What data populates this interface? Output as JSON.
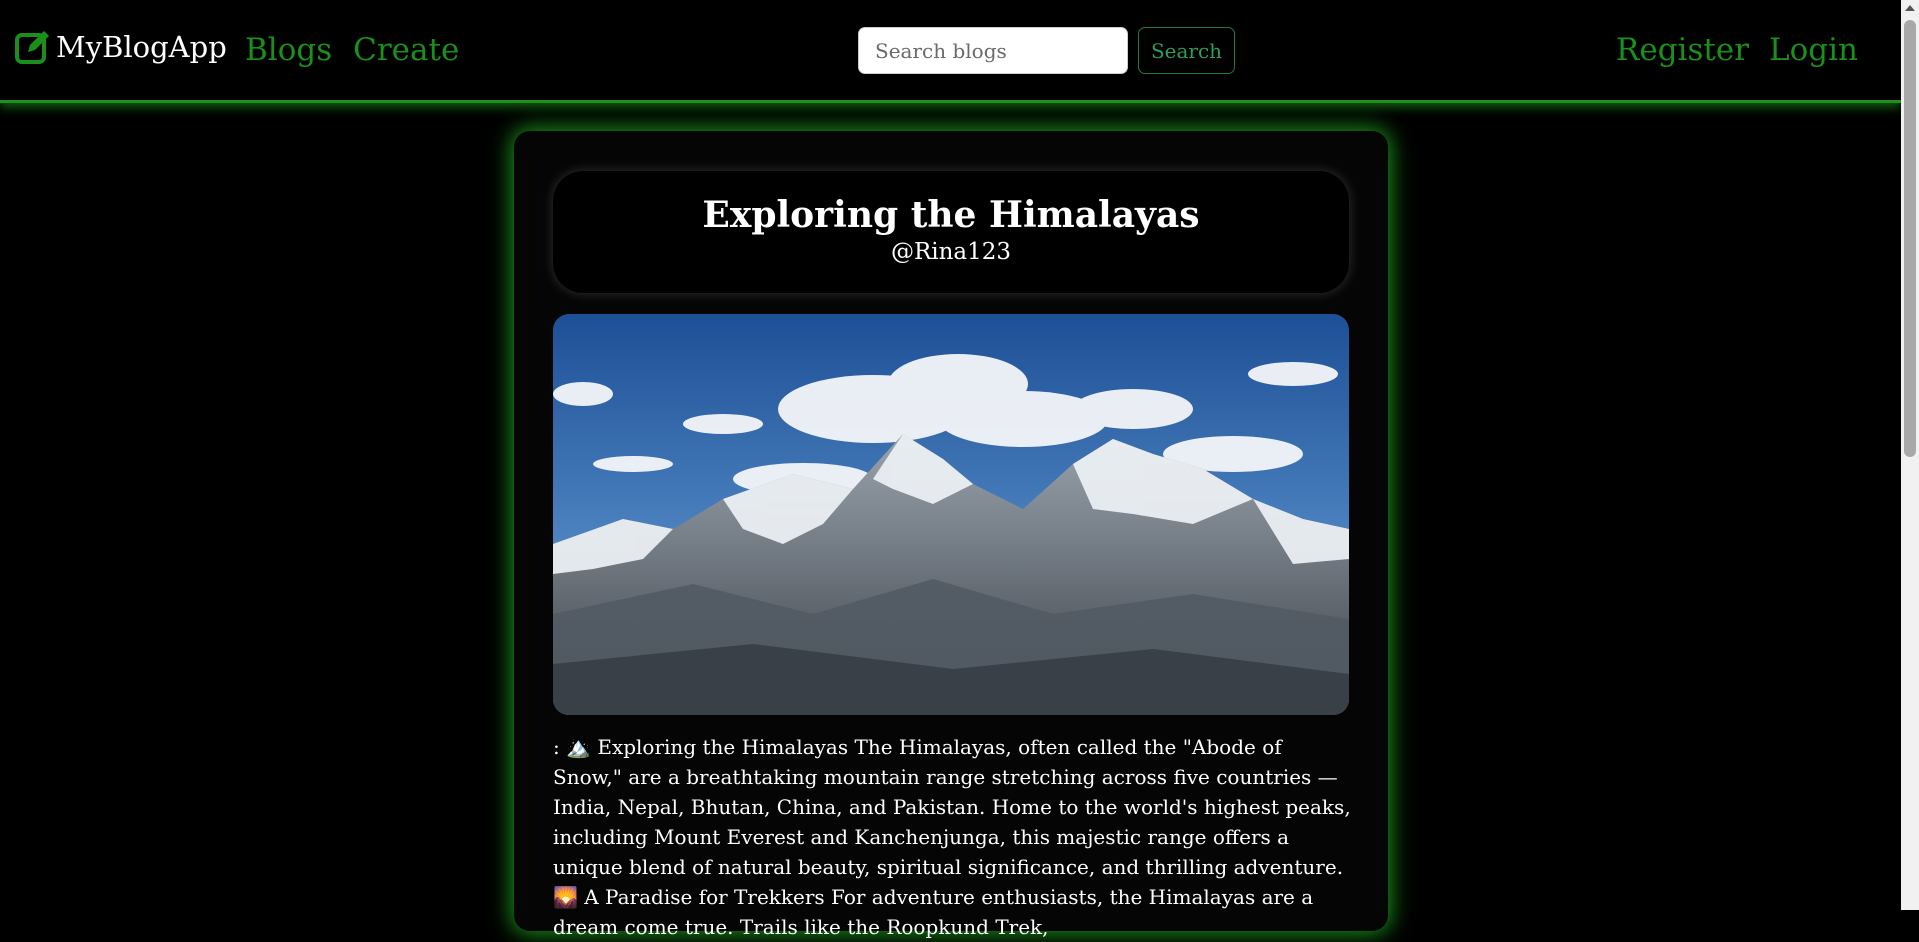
{
  "navbar": {
    "brand": "MyBlogApp",
    "links_left": [
      {
        "label": "Blogs"
      },
      {
        "label": "Create"
      }
    ],
    "search": {
      "placeholder": "Search blogs",
      "value": "",
      "button_label": "Search"
    },
    "links_right": [
      {
        "label": "Register"
      },
      {
        "label": "Login"
      }
    ],
    "colors": {
      "accent": "#1a8f1a",
      "glow": "#1fb41f",
      "background": "#000000"
    }
  },
  "post": {
    "title": "Exploring the Himalayas",
    "author": "@Rina123",
    "image_icon": "mountain-photo",
    "body": ": 🏔️ Exploring the Himalayas The Himalayas, often called the \"Abode of Snow,\" are a breathtaking mountain range stretching across five countries — India, Nepal, Bhutan, China, and Pakistan. Home to the world's highest peaks, including Mount Everest and Kanchenjunga, this majestic range offers a unique blend of natural beauty, spiritual significance, and thrilling adventure. 🌄 A Paradise for Trekkers For adventure enthusiasts, the Himalayas are a dream come true. Trails like the Roopkund Trek,"
  }
}
